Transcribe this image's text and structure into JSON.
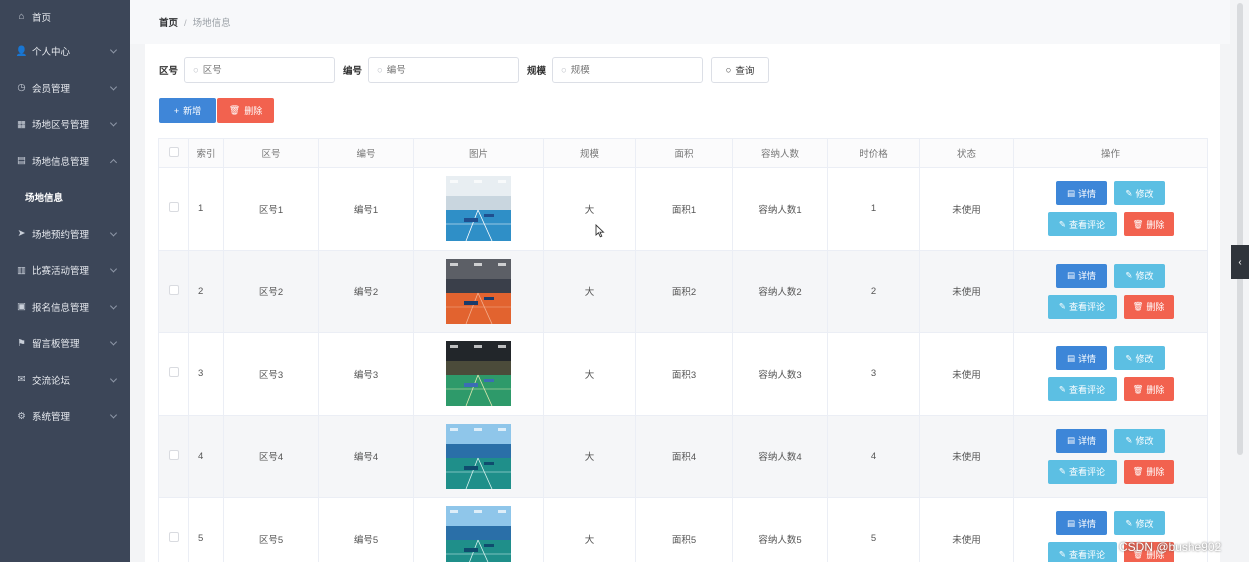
{
  "sidebar": {
    "items": [
      {
        "label": "首页",
        "icon": "home-icon",
        "glyph": "⌂",
        "has_arrow": false
      },
      {
        "label": "个人中心",
        "icon": "user-icon",
        "glyph": "👤",
        "has_arrow": true
      },
      {
        "label": "会员管理",
        "icon": "clock-icon",
        "glyph": "◷",
        "has_arrow": true
      },
      {
        "label": "场地区号管理",
        "icon": "grid-icon",
        "glyph": "▦",
        "has_arrow": true
      },
      {
        "label": "场地信息管理",
        "icon": "list-icon",
        "glyph": "▤",
        "has_arrow": true,
        "expanded": true
      },
      {
        "label": "场地信息",
        "icon": "",
        "glyph": "",
        "has_arrow": false,
        "sub": true
      },
      {
        "label": "场地预约管理",
        "icon": "send-icon",
        "glyph": "➤",
        "has_arrow": true
      },
      {
        "label": "比赛活动管理",
        "icon": "bank-icon",
        "glyph": "▥",
        "has_arrow": true
      },
      {
        "label": "报名信息管理",
        "icon": "chart-icon",
        "glyph": "▣",
        "has_arrow": true
      },
      {
        "label": "留言板管理",
        "icon": "flag-icon",
        "glyph": "⚑",
        "has_arrow": true
      },
      {
        "label": "交流论坛",
        "icon": "mail-icon",
        "glyph": "✉",
        "has_arrow": true
      },
      {
        "label": "系统管理",
        "icon": "settings-icon",
        "glyph": "⚙",
        "has_arrow": true
      }
    ]
  },
  "breadcrumb": {
    "home": "首页",
    "separator": "/",
    "current": "场地信息"
  },
  "search": {
    "fields": [
      {
        "label": "区号",
        "placeholder": "区号"
      },
      {
        "label": "编号",
        "placeholder": "编号"
      },
      {
        "label": "规模",
        "placeholder": "规模"
      }
    ],
    "query_label": "查询"
  },
  "actions": {
    "add_label": "新增",
    "delete_label": "删除"
  },
  "table": {
    "columns": [
      "",
      "索引",
      "区号",
      "编号",
      "图片",
      "规模",
      "面积",
      "容纳人数",
      "时价格",
      "状态",
      "操作"
    ],
    "rows": [
      {
        "index": "1",
        "zone": "区号1",
        "code": "编号1",
        "scale": "大",
        "area": "面积1",
        "capacity": "容纳人数1",
        "price": "1",
        "status": "未使用",
        "image": "gym-blue"
      },
      {
        "index": "2",
        "zone": "区号2",
        "code": "编号2",
        "scale": "大",
        "area": "面积2",
        "capacity": "容纳人数2",
        "price": "2",
        "status": "未使用",
        "image": "gym-orange"
      },
      {
        "index": "3",
        "zone": "区号3",
        "code": "编号3",
        "scale": "大",
        "area": "面积3",
        "capacity": "容纳人数3",
        "price": "3",
        "status": "未使用",
        "image": "gym-green"
      },
      {
        "index": "4",
        "zone": "区号4",
        "code": "编号4",
        "scale": "大",
        "area": "面积4",
        "capacity": "容纳人数4",
        "price": "4",
        "status": "未使用",
        "image": "gym-teal"
      },
      {
        "index": "5",
        "zone": "区号5",
        "code": "编号5",
        "scale": "大",
        "area": "面积5",
        "capacity": "容纳人数5",
        "price": "5",
        "status": "未使用",
        "image": "gym-teal"
      }
    ],
    "row_actions": {
      "detail": "详情",
      "edit": "修改",
      "review": "查看评论",
      "delete": "删除"
    }
  },
  "watermark": "CSDN @bushe902",
  "colors": {
    "sidebar": "#3c4658",
    "primary": "#3f86d8",
    "info": "#5cbfe3",
    "danger": "#f2624f"
  }
}
